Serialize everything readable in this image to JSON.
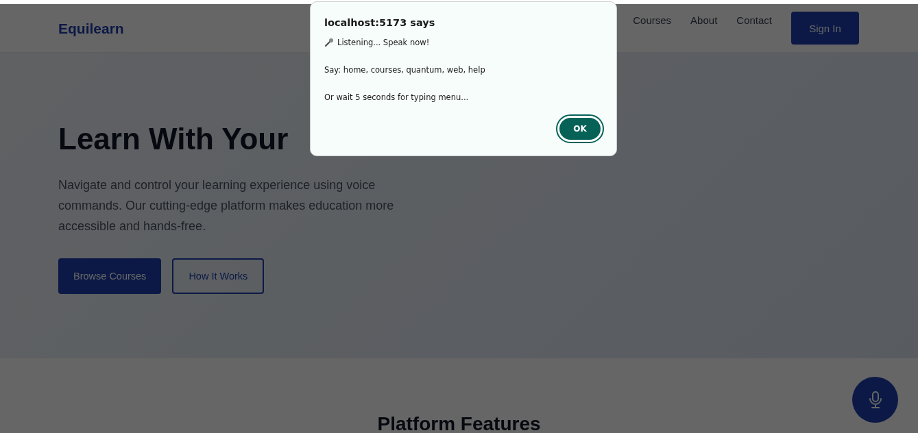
{
  "header": {
    "logo": "Equilearn",
    "nav": [
      "Courses",
      "About",
      "Contact"
    ],
    "sign_in": "Sign In"
  },
  "hero": {
    "title": "Learn With Your",
    "text": "Navigate and control your learning experience using voice commands. Our cutting-edge platform makes education more accessible and hands-free.",
    "buttons": [
      {
        "label": "Browse Courses",
        "kind": "primary"
      },
      {
        "label": "How It Works",
        "kind": "outline"
      }
    ]
  },
  "features": {
    "title": "Platform Features"
  },
  "dialog": {
    "title": "localhost:5173 says",
    "lines": [
      "Listening... Speak now!",
      "Say: home, courses, quantum, web, help",
      "Or wait 5 seconds for typing menu..."
    ],
    "ok": "OK"
  }
}
